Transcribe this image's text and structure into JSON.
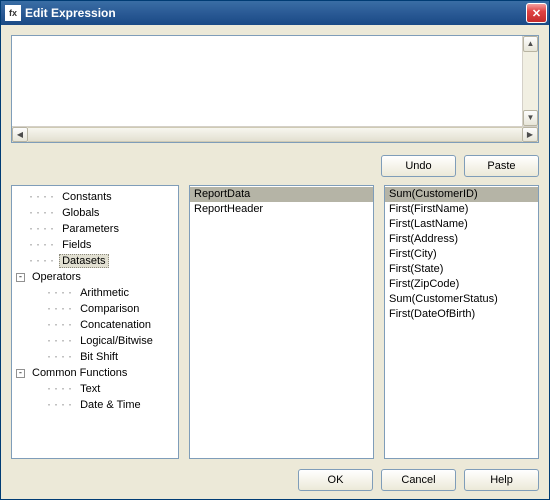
{
  "window": {
    "title": "Edit Expression",
    "icon_label": "fx"
  },
  "editor": {
    "value": "",
    "placeholder": ""
  },
  "actions": {
    "undo": "Undo",
    "paste": "Paste",
    "ok": "OK",
    "cancel": "Cancel",
    "help": "Help"
  },
  "tree": [
    {
      "label": "Constants",
      "level": 1,
      "toggle": null,
      "selected": false
    },
    {
      "label": "Globals",
      "level": 1,
      "toggle": null,
      "selected": false
    },
    {
      "label": "Parameters",
      "level": 1,
      "toggle": null,
      "selected": false
    },
    {
      "label": "Fields",
      "level": 1,
      "toggle": null,
      "selected": false
    },
    {
      "label": "Datasets",
      "level": 1,
      "toggle": null,
      "selected": true
    },
    {
      "label": "Operators",
      "level": 0,
      "toggle": "-",
      "selected": false
    },
    {
      "label": "Arithmetic",
      "level": 2,
      "toggle": null,
      "selected": false
    },
    {
      "label": "Comparison",
      "level": 2,
      "toggle": null,
      "selected": false
    },
    {
      "label": "Concatenation",
      "level": 2,
      "toggle": null,
      "selected": false
    },
    {
      "label": "Logical/Bitwise",
      "level": 2,
      "toggle": null,
      "selected": false
    },
    {
      "label": "Bit Shift",
      "level": 2,
      "toggle": null,
      "selected": false
    },
    {
      "label": "Common Functions",
      "level": 0,
      "toggle": "-",
      "selected": false
    },
    {
      "label": "Text",
      "level": 2,
      "toggle": null,
      "selected": false
    },
    {
      "label": "Date & Time",
      "level": 2,
      "toggle": null,
      "selected": false
    }
  ],
  "datasets": [
    {
      "label": "ReportData",
      "selected": true
    },
    {
      "label": "ReportHeader",
      "selected": false
    }
  ],
  "fields": [
    {
      "label": "Sum(CustomerID)",
      "selected": true
    },
    {
      "label": "First(FirstName)",
      "selected": false
    },
    {
      "label": "First(LastName)",
      "selected": false
    },
    {
      "label": "First(Address)",
      "selected": false
    },
    {
      "label": "First(City)",
      "selected": false
    },
    {
      "label": "First(State)",
      "selected": false
    },
    {
      "label": "First(ZipCode)",
      "selected": false
    },
    {
      "label": "Sum(CustomerStatus)",
      "selected": false
    },
    {
      "label": "First(DateOfBirth)",
      "selected": false
    }
  ]
}
